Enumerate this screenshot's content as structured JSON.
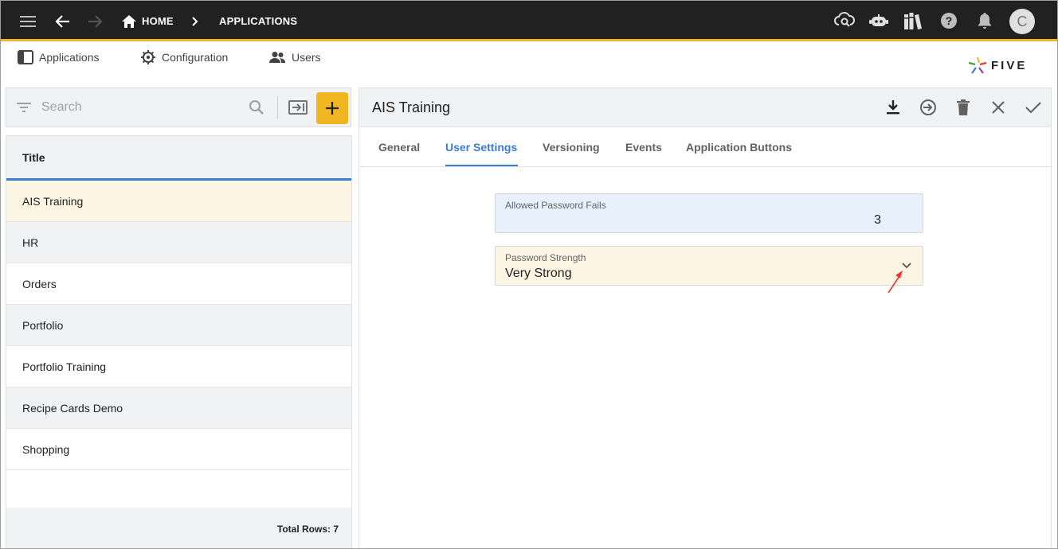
{
  "topbar": {
    "breadcrumb_home": "HOME",
    "breadcrumb_applications": "APPLICATIONS",
    "avatar_letter": "C",
    "icons": [
      "menu-icon",
      "back-arrow-icon",
      "forward-arrow-icon",
      "home-icon",
      "chevron-right-icon",
      "cloud-search-icon",
      "chatbot-icon",
      "library-icon",
      "help-icon",
      "bell-icon"
    ]
  },
  "nav": {
    "applications": "Applications",
    "configuration": "Configuration",
    "users": "Users",
    "logo_text": "FIVE"
  },
  "list_panel": {
    "search_placeholder": "Search",
    "column_title": "Title",
    "rows": [
      "AIS Training",
      "HR",
      "Orders",
      "Portfolio",
      "Portfolio Training",
      "Recipe Cards Demo",
      "Shopping"
    ],
    "selected_index": 0,
    "total_rows_label": "Total Rows: 7"
  },
  "form": {
    "title": "AIS Training",
    "tabs": [
      "General",
      "User Settings",
      "Versioning",
      "Events",
      "Application Buttons"
    ],
    "active_tab": "User Settings",
    "fields": {
      "allowed_password_fails_label": "Allowed Password Fails",
      "allowed_password_fails_value": "3",
      "password_strength_label": "Password Strength",
      "password_strength_value": "Very Strong"
    }
  },
  "colors": {
    "topbar_bg": "#212121",
    "accent_yellow": "#f2b622",
    "accent_blue": "#3b7bd4",
    "selected_row": "#fdf5e3",
    "alt_row": "#f1f2f3",
    "annotation_arrow": "#e53935"
  }
}
